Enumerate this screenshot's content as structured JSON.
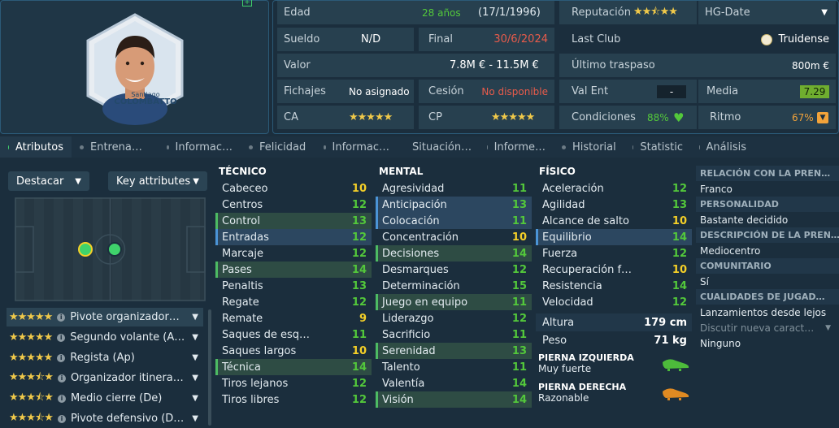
{
  "profile": {
    "name_small": "Santiago",
    "name_big": "COLOMBATTO"
  },
  "info": {
    "edad_label": "Edad",
    "edad_val": "28 años",
    "edad_date": "(17/1/1996)",
    "sueldo_label": "Sueldo",
    "sueldo_val": "N/D",
    "final_label": "Final",
    "final_val": "30/6/2024",
    "valor_label": "Valor",
    "valor_val": "7.8M € - 11.5M €",
    "fichajes_label": "Fichajes",
    "fichajes_val": "No asignado",
    "cesion_label": "Cesión",
    "cesion_val": "No disponible",
    "ca_label": "CA",
    "cp_label": "CP",
    "reput_label": "Reputación",
    "hg_label": "HG-Date",
    "lastclub_label": "Last Club",
    "lastclub_val": "Truidense",
    "traspaso_label": "Último traspaso",
    "traspaso_val": "800m €",
    "valent_label": "Val Ent",
    "valent_val": "-",
    "media_label": "Media",
    "media_val": "7.29",
    "cond_label": "Condiciones",
    "cond_val": "88%",
    "ritmo_label": "Ritmo",
    "ritmo_val": "67%",
    "ca_stars": 4,
    "cp_stars": 4,
    "reput_stars": 2.5
  },
  "tabs": [
    "Atributos",
    "Entrena…",
    "Informac…",
    "Felicidad",
    "Informac…",
    "Situación…",
    "Informe…",
    "Historial",
    "Statistic",
    "Análisis"
  ],
  "left": {
    "destacar": "Destacar",
    "key_attr": "Key attributes",
    "roles": [
      {
        "name": "Pivote organizador…",
        "stars": 4
      },
      {
        "name": "Segundo volante (A…",
        "stars": 4
      },
      {
        "name": "Regista (Ap)",
        "stars": 4
      },
      {
        "name": "Organizador itinera…",
        "stars": 3.5
      },
      {
        "name": "Medio cierre (De)",
        "stars": 3.5
      },
      {
        "name": "Pivote defensivo (D…",
        "stars": 3.5
      }
    ]
  },
  "tecnico": {
    "title": "TÉCNICO",
    "rows": [
      {
        "n": "Cabeceo",
        "v": "10",
        "h": ""
      },
      {
        "n": "Centros",
        "v": "12",
        "h": ""
      },
      {
        "n": "Control",
        "v": "13",
        "h": "g"
      },
      {
        "n": "Entradas",
        "v": "12",
        "h": "b"
      },
      {
        "n": "Marcaje",
        "v": "12",
        "h": ""
      },
      {
        "n": "Pases",
        "v": "14",
        "h": "g"
      },
      {
        "n": "Penaltis",
        "v": "13",
        "h": ""
      },
      {
        "n": "Regate",
        "v": "12",
        "h": ""
      },
      {
        "n": "Remate",
        "v": "9",
        "h": ""
      },
      {
        "n": "Saques de esq…",
        "v": "11",
        "h": ""
      },
      {
        "n": "Saques largos",
        "v": "10",
        "h": ""
      },
      {
        "n": "Técnica",
        "v": "14",
        "h": "g"
      },
      {
        "n": "Tiros lejanos",
        "v": "12",
        "h": ""
      },
      {
        "n": "Tiros libres",
        "v": "12",
        "h": ""
      }
    ]
  },
  "mental": {
    "title": "MENTAL",
    "rows": [
      {
        "n": "Agresividad",
        "v": "11",
        "h": ""
      },
      {
        "n": "Anticipación",
        "v": "13",
        "h": "b"
      },
      {
        "n": "Colocación",
        "v": "11",
        "h": "b"
      },
      {
        "n": "Concentración",
        "v": "10",
        "h": ""
      },
      {
        "n": "Decisiones",
        "v": "14",
        "h": "g"
      },
      {
        "n": "Desmarques",
        "v": "12",
        "h": ""
      },
      {
        "n": "Determinación",
        "v": "15",
        "h": ""
      },
      {
        "n": "Juego en equipo",
        "v": "11",
        "h": "g"
      },
      {
        "n": "Liderazgo",
        "v": "12",
        "h": ""
      },
      {
        "n": "Sacrificio",
        "v": "11",
        "h": ""
      },
      {
        "n": "Serenidad",
        "v": "13",
        "h": "g"
      },
      {
        "n": "Talento",
        "v": "11",
        "h": ""
      },
      {
        "n": "Valentía",
        "v": "14",
        "h": ""
      },
      {
        "n": "Visión",
        "v": "14",
        "h": "g"
      }
    ]
  },
  "fisico": {
    "title": "FÍSICO",
    "rows": [
      {
        "n": "Aceleración",
        "v": "12",
        "h": ""
      },
      {
        "n": "Agilidad",
        "v": "13",
        "h": ""
      },
      {
        "n": "Alcance de salto",
        "v": "10",
        "h": ""
      },
      {
        "n": "Equilibrio",
        "v": "14",
        "h": "b"
      },
      {
        "n": "Fuerza",
        "v": "12",
        "h": ""
      },
      {
        "n": "Recuperación f…",
        "v": "10",
        "h": ""
      },
      {
        "n": "Resistencia",
        "v": "14",
        "h": ""
      },
      {
        "n": "Velocidad",
        "v": "12",
        "h": ""
      }
    ],
    "altura_label": "Altura",
    "altura_val": "179 cm",
    "peso_label": "Peso",
    "peso_val": "71 kg",
    "pie_izq_label": "PIERNA IZQUIERDA",
    "pie_izq_val": "Muy fuerte",
    "pie_der_label": "PIERNA DERECHA",
    "pie_der_val": "Razonable"
  },
  "right": {
    "items": [
      {
        "h": "RELACIÓN CON LA PREN…",
        "t": "Franco"
      },
      {
        "h": "PERSONALIDAD",
        "t": "Bastante decidido"
      },
      {
        "h": "DESCRIPCIÓN DE LA PREN…",
        "t": "Mediocentro"
      },
      {
        "h": "COMUNITARIO",
        "t": "Sí"
      },
      {
        "h": "CUALIDADES DE JUGAD…",
        "t": "Lanzamientos desde lejos"
      }
    ],
    "discutir": "Discutir nueva caract…",
    "ninguno": "Ninguno"
  },
  "colors": {
    "green": "#53c83b",
    "yellow": "#f5d028",
    "red": "#e85b4b",
    "orange": "#f2a33a"
  }
}
